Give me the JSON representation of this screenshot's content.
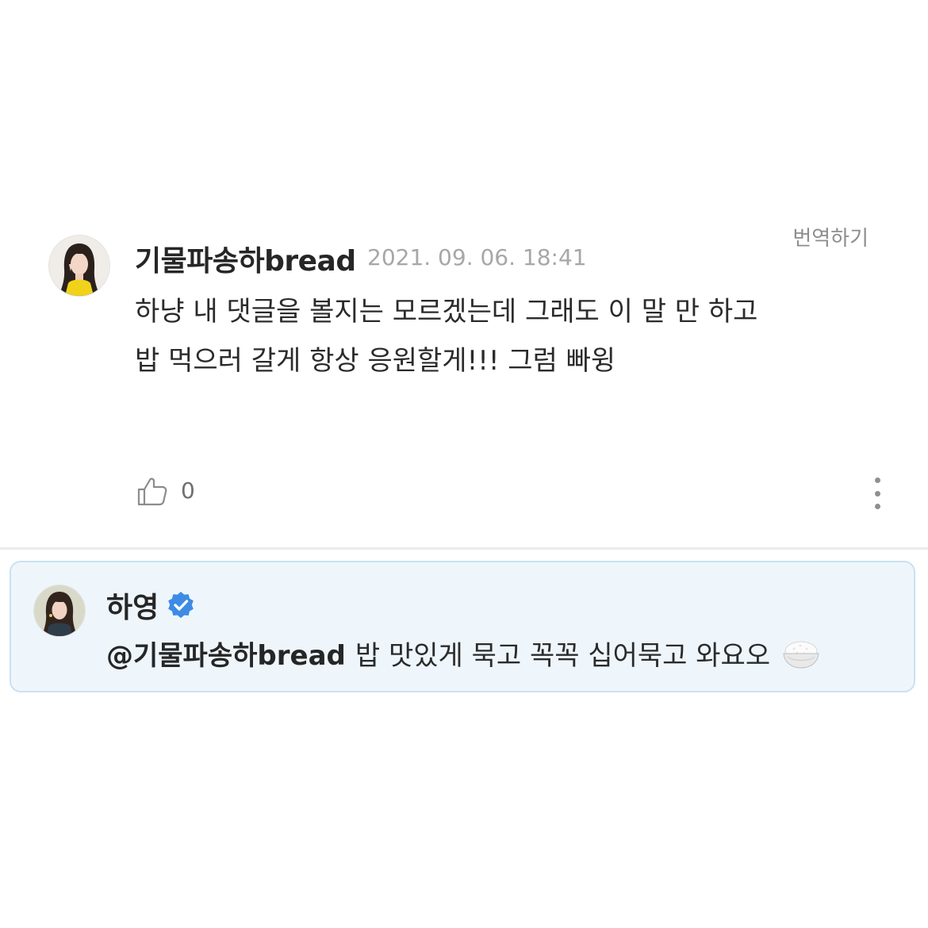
{
  "comment": {
    "author": "기물파송하bread",
    "timestamp": "2021. 09. 06. 18:41",
    "translate_label": "번역하기",
    "body": "하냥 내 댓글을 볼지는 모르겠는데 그래도 이 말 만 하고 밥 먹으러 갈게 항상 응원할게!!! 그럼 빠윙",
    "like_count": "0",
    "avatar_icon": "user-avatar-photo"
  },
  "reply": {
    "author": "하영",
    "verified_icon": "verified-badge-icon",
    "mention": "@기물파송하bread",
    "body": "밥 맛있게 묵고 꼭꼭 십어묵고 와요오",
    "emoji": "rice-bowl-icon",
    "avatar_icon": "artist-avatar-photo"
  },
  "colors": {
    "reply_background": "#eef6fc",
    "reply_border": "#c9e1f1",
    "verified_blue": "#3d8be5",
    "timestamp_gray": "#a7a7a7"
  }
}
